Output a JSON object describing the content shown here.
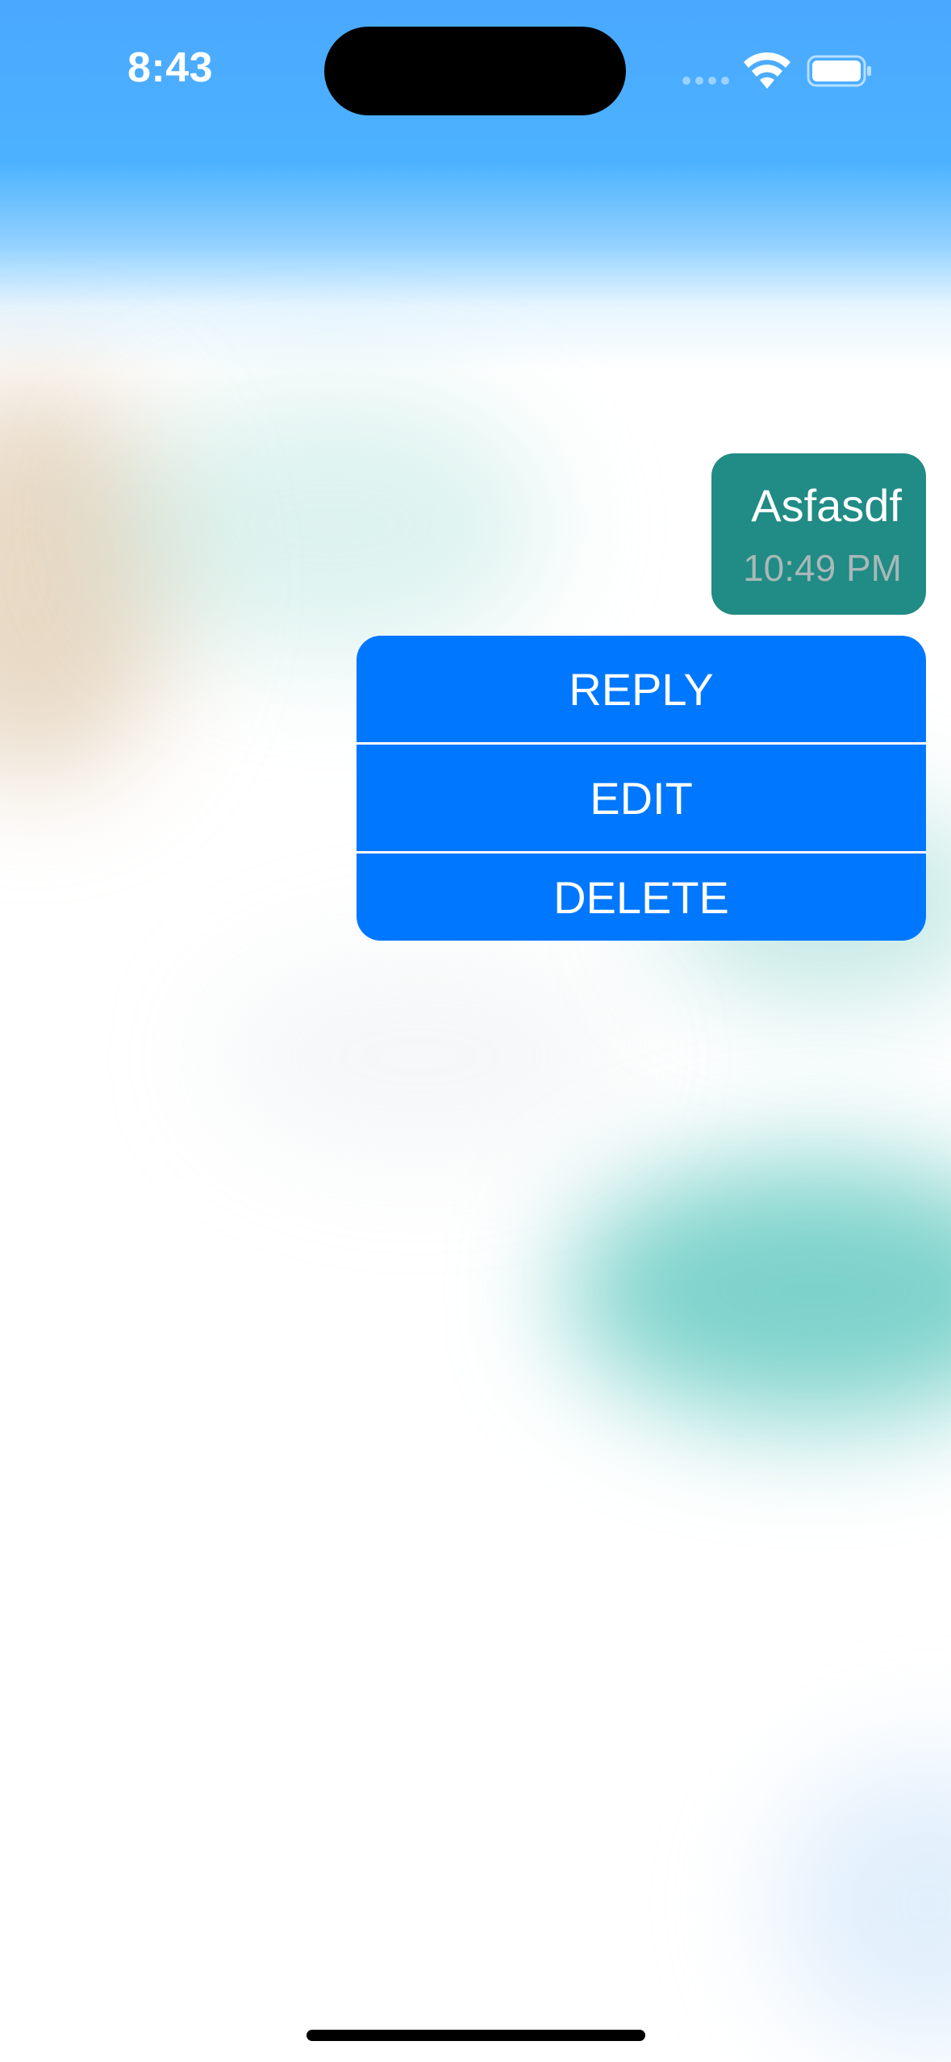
{
  "status_bar": {
    "time": "8:43",
    "icons": [
      "signal-dots-icon",
      "wifi-icon",
      "battery-icon"
    ]
  },
  "message": {
    "text": "Asfasdf",
    "time": "10:49 PM",
    "bubble_color": "#218b85"
  },
  "context_menu": {
    "items": [
      {
        "label": "REPLY"
      },
      {
        "label": "EDIT"
      },
      {
        "label": "DELETE"
      }
    ],
    "color": "#0077ff"
  }
}
